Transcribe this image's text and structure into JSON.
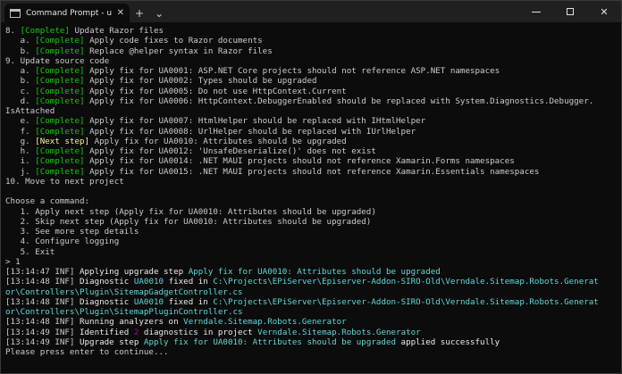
{
  "window": {
    "tab_title": "Command Prompt - upgrade-as",
    "tab_close": "✕",
    "new_tab": "+",
    "dropdown": "⌄",
    "minimize": "—",
    "close": "✕"
  },
  "colors": {
    "background": "#0c0c0c",
    "text": "#cccccc",
    "complete": "#16c60c",
    "next_step": "#f9f1a5",
    "highlight": "#61d6d6",
    "count": "#b4009e"
  },
  "lines": [
    [
      {
        "t": "8. ",
        "c": ""
      },
      {
        "t": "[Complete]",
        "c": "green"
      },
      {
        "t": " Update Razor files",
        "c": ""
      }
    ],
    [
      {
        "t": "   a. ",
        "c": ""
      },
      {
        "t": "[Complete]",
        "c": "green"
      },
      {
        "t": " Apply code fixes to Razor documents",
        "c": ""
      }
    ],
    [
      {
        "t": "   b. ",
        "c": ""
      },
      {
        "t": "[Complete]",
        "c": "green"
      },
      {
        "t": " Replace @helper syntax in Razor files",
        "c": ""
      }
    ],
    [
      {
        "t": "9. Update source code",
        "c": ""
      }
    ],
    [
      {
        "t": "   a. ",
        "c": ""
      },
      {
        "t": "[Complete]",
        "c": "green"
      },
      {
        "t": " Apply fix for UA0001: ASP.NET Core projects should not reference ASP.NET namespaces",
        "c": ""
      }
    ],
    [
      {
        "t": "   b. ",
        "c": ""
      },
      {
        "t": "[Complete]",
        "c": "green"
      },
      {
        "t": " Apply fix for UA0002: Types should be upgraded",
        "c": ""
      }
    ],
    [
      {
        "t": "   c. ",
        "c": ""
      },
      {
        "t": "[Complete]",
        "c": "green"
      },
      {
        "t": " Apply fix for UA0005: Do not use HttpContext.Current",
        "c": ""
      }
    ],
    [
      {
        "t": "   d. ",
        "c": ""
      },
      {
        "t": "[Complete]",
        "c": "green"
      },
      {
        "t": " Apply fix for UA0006: HttpContext.DebuggerEnabled should be replaced with System.Diagnostics.Debugger.",
        "c": ""
      }
    ],
    [
      {
        "t": "IsAttached",
        "c": ""
      }
    ],
    [
      {
        "t": "   e. ",
        "c": ""
      },
      {
        "t": "[Complete]",
        "c": "green"
      },
      {
        "t": " Apply fix for UA0007: HtmlHelper should be replaced with IHtmlHelper",
        "c": ""
      }
    ],
    [
      {
        "t": "   f. ",
        "c": ""
      },
      {
        "t": "[Complete]",
        "c": "green"
      },
      {
        "t": " Apply fix for UA0008: UrlHelper should be replaced with IUrlHelper",
        "c": ""
      }
    ],
    [
      {
        "t": "   g. ",
        "c": ""
      },
      {
        "t": "[Next step]",
        "c": "yellow"
      },
      {
        "t": " Apply fix for UA0010: Attributes should be upgraded",
        "c": ""
      }
    ],
    [
      {
        "t": "   h. ",
        "c": ""
      },
      {
        "t": "[Complete]",
        "c": "green"
      },
      {
        "t": " Apply fix for UA0012: 'UnsafeDeserialize()' does not exist",
        "c": ""
      }
    ],
    [
      {
        "t": "   i. ",
        "c": ""
      },
      {
        "t": "[Complete]",
        "c": "green"
      },
      {
        "t": " Apply fix for UA0014: .NET MAUI projects should not reference Xamarin.Forms namespaces",
        "c": ""
      }
    ],
    [
      {
        "t": "   j. ",
        "c": ""
      },
      {
        "t": "[Complete]",
        "c": "green"
      },
      {
        "t": " Apply fix for UA0015: .NET MAUI projects should not reference Xamarin.Essentials namespaces",
        "c": ""
      }
    ],
    [
      {
        "t": "10. Move to next project",
        "c": ""
      }
    ],
    [
      {
        "t": "",
        "c": ""
      }
    ],
    [
      {
        "t": "Choose a command:",
        "c": ""
      }
    ],
    [
      {
        "t": "   1. Apply next step (Apply fix for UA0010: Attributes should be upgraded)",
        "c": ""
      }
    ],
    [
      {
        "t": "   2. Skip next step (Apply fix for UA0010: Attributes should be upgraded)",
        "c": ""
      }
    ],
    [
      {
        "t": "   3. See more step details",
        "c": ""
      }
    ],
    [
      {
        "t": "   4. Configure logging",
        "c": ""
      }
    ],
    [
      {
        "t": "   5. Exit",
        "c": ""
      }
    ],
    [
      {
        "t": "> 1",
        "c": ""
      }
    ],
    [
      {
        "t": "[13:14:47 INF] ",
        "c": ""
      },
      {
        "t": "Applying upgrade step ",
        "c": "white"
      },
      {
        "t": "Apply fix for UA0010: Attributes should be upgraded",
        "c": "cyan"
      }
    ],
    [
      {
        "t": "[13:14:48 INF] ",
        "c": ""
      },
      {
        "t": "Diagnostic ",
        "c": "white"
      },
      {
        "t": "UA0010",
        "c": "cyan"
      },
      {
        "t": " fixed in ",
        "c": "white"
      },
      {
        "t": "C:\\Projects\\EPiServer\\Episerver-Addon-SIRO-Old\\Verndale.Sitemap.Robots.Generat",
        "c": "cyan"
      }
    ],
    [
      {
        "t": "or\\Controllers\\Plugin\\SitemapGadgetController.cs",
        "c": "cyan"
      }
    ],
    [
      {
        "t": "[13:14:48 INF] ",
        "c": ""
      },
      {
        "t": "Diagnostic ",
        "c": "white"
      },
      {
        "t": "UA0010",
        "c": "cyan"
      },
      {
        "t": " fixed in ",
        "c": "white"
      },
      {
        "t": "C:\\Projects\\EPiServer\\Episerver-Addon-SIRO-Old\\Verndale.Sitemap.Robots.Generat",
        "c": "cyan"
      }
    ],
    [
      {
        "t": "or\\Controllers\\Plugin\\SitemapPluginController.cs",
        "c": "cyan"
      }
    ],
    [
      {
        "t": "[13:14:48 INF] ",
        "c": ""
      },
      {
        "t": "Running analyzers on ",
        "c": "white"
      },
      {
        "t": "Verndale.Sitemap.Robots.Generator",
        "c": "cyan"
      }
    ],
    [
      {
        "t": "[13:14:49 INF] ",
        "c": ""
      },
      {
        "t": "Identified ",
        "c": "white"
      },
      {
        "t": "2",
        "c": "magenta"
      },
      {
        "t": " diagnostics in project ",
        "c": "white"
      },
      {
        "t": "Verndale.Sitemap.Robots.Generator",
        "c": "cyan"
      }
    ],
    [
      {
        "t": "[13:14:49 INF] ",
        "c": ""
      },
      {
        "t": "Upgrade step ",
        "c": "white"
      },
      {
        "t": "Apply fix for UA0010: Attributes should be upgraded",
        "c": "cyan"
      },
      {
        "t": " applied successfully",
        "c": "white"
      }
    ],
    [
      {
        "t": "Please press enter to continue...",
        "c": ""
      }
    ]
  ]
}
